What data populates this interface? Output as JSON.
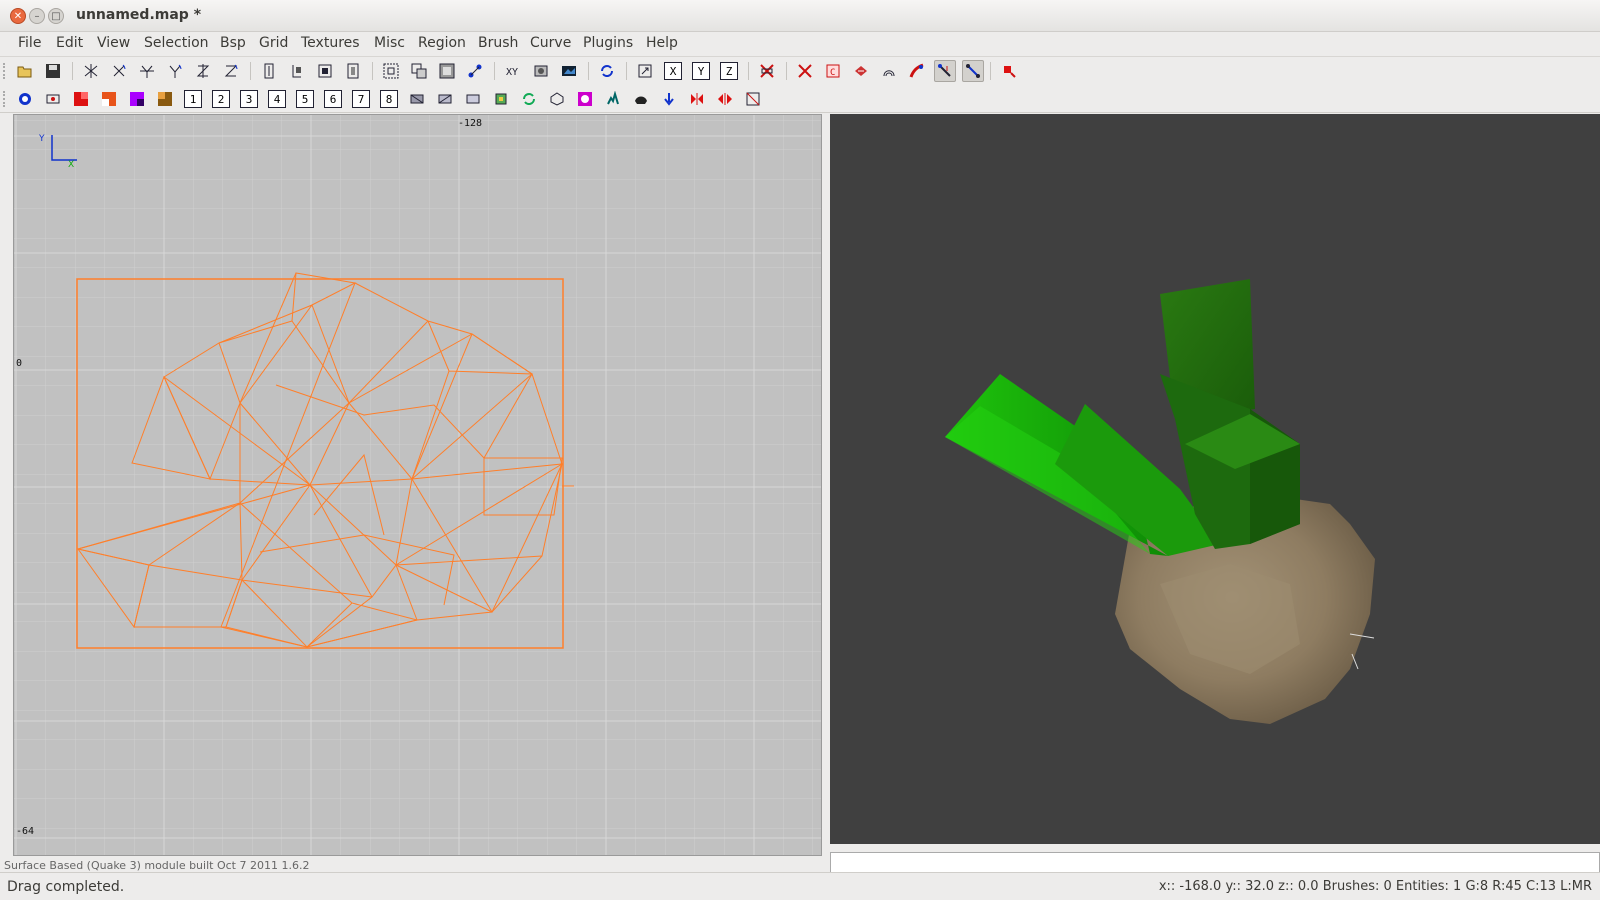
{
  "window": {
    "title": "unnamed.map *"
  },
  "menu": [
    "File",
    "Edit",
    "View",
    "Selection",
    "Bsp",
    "Grid",
    "Textures",
    "Misc",
    "Region",
    "Brush",
    "Curve",
    "Plugins",
    "Help"
  ],
  "toolbar1_icons": [
    "open-icon",
    "save-icon",
    "x-axis-flip-icon",
    "x-axis-rotate-icon",
    "y-axis-flip-icon",
    "y-axis-rotate-icon",
    "z-axis-flip-icon",
    "z-axis-rotate-icon",
    "complete-tall-icon",
    "size-to-fit-icon",
    "select-inside-icon",
    "select-touching-icon",
    "csg-hollow-icon",
    "csg-subtract-icon",
    "csg-merge-icon",
    "csg-make-room-icon",
    "vertex-mode-icon",
    "change-views-icon",
    "texture-lock-icon",
    "camera-icon",
    "refresh-icon",
    "view-xy-icon",
    "view-xz-icon",
    "view-yz-icon",
    "view-z-icon",
    "clipper-icon",
    "cubic-clip-icon",
    "patch-icon",
    "entity-icon",
    "lights-icon",
    "patch-bend-icon",
    "select-face-icon",
    "drag-edges-icon",
    "drag-vertices-icon",
    "shader-icon"
  ],
  "toolbar1_labels": {
    "view-xy-icon": "X",
    "view-xz-icon": "Y",
    "view-yz-icon": "Z"
  },
  "toolbar2_labels": [
    "1",
    "2",
    "3",
    "4",
    "5",
    "6",
    "7",
    "8"
  ],
  "view2d": {
    "axis_y_label": "Y",
    "axis_x_label": "X",
    "coord_top": "-128",
    "coord_left": "0",
    "coord_bottom": "-64"
  },
  "status": {
    "message": "Drag completed.",
    "info": "x:: -168.0  y:: 32.0  z:: 0.0  Brushes: 0 Entities: 1   G:8 R:45 C:13 L:MR",
    "strip": "Surface Based (Quake 3) module built Oct 7 2011 1.6.2"
  },
  "colors": {
    "wire": "#ff7f2a",
    "grid_bg": "#c1c1c1",
    "viewport_3d": "#404040",
    "foliage": "#1f8a10",
    "rock": "#9a8970"
  }
}
